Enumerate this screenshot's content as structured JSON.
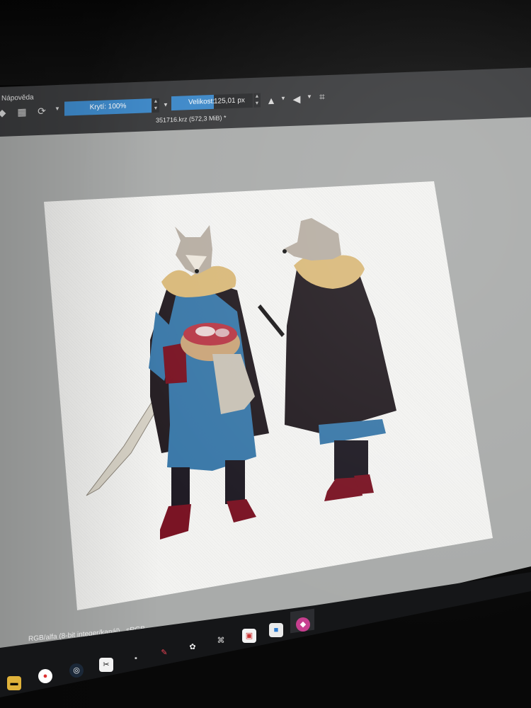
{
  "menu": {
    "help_label": "Nápověda"
  },
  "toolbar": {
    "opacity_label": "Krytí: 100%",
    "size_label": "Velikost:",
    "size_value": "125,01 px"
  },
  "document": {
    "tab_title": "351716.krz (572,3 MiB) *"
  },
  "status_bar": {
    "color_model": "RGB/alfa (8-bit integer/kanál)",
    "color_profile": "sRGB"
  },
  "colors": {
    "toolbar_bg": "#3a3b3d",
    "accent_blue": "#3d88c8",
    "canvas_bg": "#f3f3f1",
    "workspace_bg": "#a9abaa",
    "coat_blue": "#3a78a8",
    "cloak_black": "#241d22",
    "boots_red": "#7a1424",
    "fur_gold": "#d9b97a"
  },
  "taskbar": {
    "icons": [
      "folder-icon",
      "chrome-icon",
      "steam-icon",
      "capcut-icon",
      "app-icon",
      "pen-icon",
      "paint-icon",
      "app-icon-2",
      "app-icon-3",
      "app-icon-4",
      "krita-icon"
    ]
  }
}
